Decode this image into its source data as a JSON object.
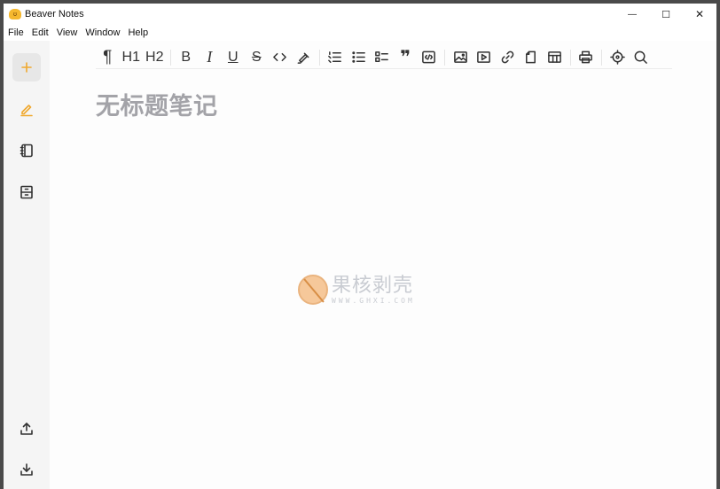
{
  "window": {
    "title": "Beaver Notes",
    "app_icon_glyph": "ʊ",
    "controls": {
      "minimize": "—",
      "maximize": "☐",
      "close": "✕"
    }
  },
  "menu": {
    "items": [
      "File",
      "Edit",
      "View",
      "Window",
      "Help"
    ]
  },
  "sidebar": {
    "top": [
      {
        "name": "new-note",
        "icon": "plus-icon",
        "color": "#f0a92e"
      },
      {
        "name": "notes",
        "icon": "pencil-icon",
        "color": "#f0a92e"
      },
      {
        "name": "notebooks",
        "icon": "notebook-icon",
        "color": "#333333"
      },
      {
        "name": "archive",
        "icon": "archive-icon",
        "color": "#333333"
      }
    ],
    "bottom": [
      {
        "name": "export",
        "icon": "upload-icon"
      },
      {
        "name": "import",
        "icon": "download-icon"
      }
    ]
  },
  "toolbar": {
    "paragraph": "¶",
    "h1": "H1",
    "h2": "H2",
    "bold": "B",
    "italic": "I",
    "underline": "U",
    "strike": "S",
    "quote": "❞"
  },
  "note": {
    "title_placeholder": "无标题笔记"
  },
  "watermark": {
    "main": "果核剥壳",
    "sub": "WWW.GHXI.COM"
  },
  "colors": {
    "accent": "#f0a92e",
    "title_placeholder": "#a3a3a8"
  }
}
